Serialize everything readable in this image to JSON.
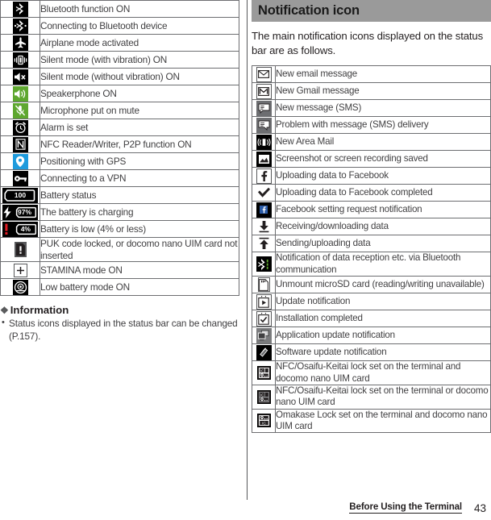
{
  "footer": {
    "chapter": "Before Using the Terminal",
    "page_number": "43"
  },
  "left_column": {
    "status_table": {
      "rows": [
        {
          "icon": "bluetooth-on-icon",
          "label": "Bluetooth function ON"
        },
        {
          "icon": "bluetooth-connecting-icon",
          "label": "Connecting to Bluetooth device"
        },
        {
          "icon": "airplane-mode-icon",
          "label": "Airplane mode activated"
        },
        {
          "icon": "silent-vibrate-icon",
          "label": "Silent mode (with vibration) ON"
        },
        {
          "icon": "silent-mute-icon",
          "label": "Silent mode (without vibration) ON"
        },
        {
          "icon": "speakerphone-icon",
          "label": "Speakerphone ON"
        },
        {
          "icon": "microphone-mute-icon",
          "label": "Microphone put on mute"
        },
        {
          "icon": "alarm-clock-icon",
          "label": "Alarm is set"
        },
        {
          "icon": "nfc-icon",
          "label": "NFC Reader/Writer, P2P function ON"
        },
        {
          "icon": "gps-pin-icon",
          "label": "Positioning with GPS"
        },
        {
          "icon": "vpn-key-icon",
          "label": "Connecting to a VPN"
        },
        {
          "icon": "battery-status-icon",
          "label": "Battery status",
          "value": "100"
        },
        {
          "icon": "battery-charging-icon",
          "label": "The battery is charging",
          "value": "97%"
        },
        {
          "icon": "battery-low-icon",
          "label": "Battery is low (4% or less)",
          "value": "4%"
        },
        {
          "icon": "sim-card-error-icon",
          "label": "PUK code locked, or docomo nano UIM card not inserted"
        },
        {
          "icon": "stamina-mode-icon",
          "label": "STAMINA mode ON"
        },
        {
          "icon": "low-battery-mode-icon",
          "label": "Low battery mode ON"
        }
      ]
    },
    "information": {
      "heading": "Information",
      "items": [
        "Status icons displayed in the status bar can be changed (P.157)."
      ]
    }
  },
  "right_column": {
    "section_title": "Notification icon",
    "intro": "The main notification icons displayed on the status bar are as follows.",
    "notification_table": {
      "rows": [
        {
          "icon": "email-envelope-icon",
          "label": "New email message"
        },
        {
          "icon": "gmail-icon",
          "label": "New Gmail message"
        },
        {
          "icon": "sms-new-icon",
          "label": "New message (SMS)"
        },
        {
          "icon": "sms-problem-icon",
          "label": "Problem with message (SMS) delivery"
        },
        {
          "icon": "area-mail-icon",
          "label": "New Area Mail"
        },
        {
          "icon": "screenshot-saved-icon",
          "label": "Screenshot or screen recording saved"
        },
        {
          "icon": "facebook-upload-icon",
          "label": "Uploading data to Facebook"
        },
        {
          "icon": "facebook-upload-done-icon",
          "label": "Uploading data to Facebook completed"
        },
        {
          "icon": "facebook-setting-icon",
          "label": "Facebook setting request notification"
        },
        {
          "icon": "download-arrow-icon",
          "label": "Receiving/downloading data"
        },
        {
          "icon": "upload-arrow-icon",
          "label": "Sending/uploading data"
        },
        {
          "icon": "bluetooth-transfer-icon",
          "label": "Notification of data reception etc. via Bluetooth communication"
        },
        {
          "icon": "microsd-unmount-icon",
          "label": "Unmount microSD card (reading/writing unavailable)"
        },
        {
          "icon": "update-notification-icon",
          "label": "Update notification"
        },
        {
          "icon": "install-complete-icon",
          "label": "Installation completed"
        },
        {
          "icon": "app-update-icon",
          "label": "Application update notification"
        },
        {
          "icon": "software-update-icon",
          "label": "Software update notification"
        },
        {
          "icon": "nfc-lock-both-icon",
          "label": "NFC/Osaifu-Keitai lock set on the terminal and docomo nano UIM card"
        },
        {
          "icon": "nfc-lock-either-icon",
          "label": "NFC/Osaifu-Keitai lock set on the terminal or docomo nano UIM card"
        },
        {
          "icon": "omakase-lock-icon",
          "label": "Omakase Lock set on the terminal and docomo nano UIM card"
        }
      ]
    }
  },
  "colors": {
    "section_bar": "#9a9a9a",
    "table_border": "#6d6e71",
    "text": "#414042",
    "icon_dark": "#000000",
    "icon_green": "#5ea72f",
    "icon_blue": "#1e9bdd",
    "icon_red": "#e01b24"
  }
}
